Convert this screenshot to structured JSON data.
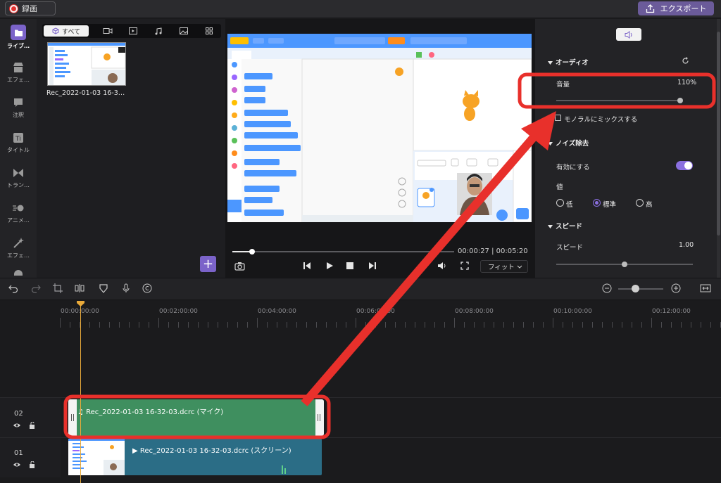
{
  "titlebar": {
    "record_label": "録画",
    "export_label": "エクスポート"
  },
  "leftnav": {
    "items": [
      {
        "label": "ライブ…",
        "icon": "folder-icon",
        "active": true
      },
      {
        "label": "エフェ…",
        "icon": "store-icon"
      },
      {
        "label": "注釈",
        "icon": "annotation-icon"
      },
      {
        "label": "タイトル",
        "icon": "title-icon"
      },
      {
        "label": "トラン…",
        "icon": "transition-icon"
      },
      {
        "label": "アニメ…",
        "icon": "animation-icon"
      },
      {
        "label": "エフェ…",
        "icon": "magic-wand-icon"
      }
    ]
  },
  "library": {
    "tab_all_label": "すべて",
    "clip_name": "Rec_2022-01-03 16-3…"
  },
  "preview": {
    "timecode": "00:00:27 | 00:05:20",
    "fit_label": "フィット",
    "progress": 0.09
  },
  "props": {
    "audio_header": "オーディオ",
    "volume_label": "音量",
    "volume_value": "110%",
    "mono_label": "モノラルにミックスする",
    "noise_header": "ノイズ除去",
    "enable_label": "有効にする",
    "level_label": "値",
    "level_low": "低",
    "level_standard": "標準",
    "level_high": "高",
    "level_selected": "標準",
    "speed_header": "スピード",
    "speed_label": "スピード",
    "speed_value": "1.00"
  },
  "timeline": {
    "ruler": [
      "00:00:00:00",
      "00:02:00:00",
      "00:04:00:00",
      "00:06:00:00",
      "00:08:00:00",
      "00:10:00:00",
      "00:12:00:00"
    ],
    "tracks": [
      {
        "number": "02",
        "clip_label": "Rec_2022-01-03 16-32-03.dcrc (マイク)"
      },
      {
        "number": "01",
        "clip_label": "Rec_2022-01-03 16-32-03.dcrc (スクリーン)"
      }
    ]
  },
  "colors": {
    "accent": "#7b63c9",
    "annotation": "#e8302b",
    "audio_clip": "#3f8f5f",
    "video_clip": "#2b6d86",
    "playhead": "#e8a93a"
  }
}
